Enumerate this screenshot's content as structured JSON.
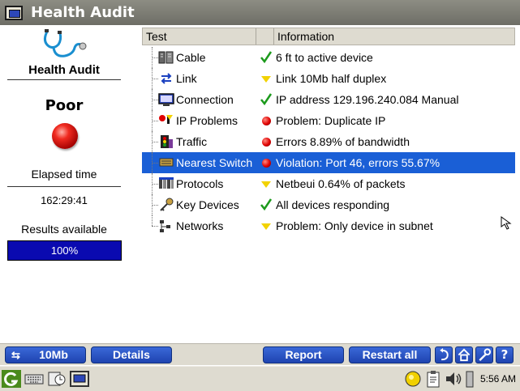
{
  "window": {
    "title": "Health Audit"
  },
  "left_panel": {
    "app_name": "Health Audit",
    "status": "Poor",
    "status_color": "#e00000",
    "elapsed_label": "Elapsed time",
    "elapsed_value": "162:29:41",
    "results_label": "Results available",
    "progress_percent": 100,
    "progress_text": "100%"
  },
  "table": {
    "columns": [
      "Test",
      "",
      "Information"
    ],
    "rows": [
      {
        "name": "Cable",
        "icon": "cable-icon",
        "status": "ok",
        "info": "6 ft to active device",
        "selected": false
      },
      {
        "name": "Link",
        "icon": "link-icon",
        "status": "warning",
        "info": "Link 10Mb half duplex",
        "selected": false
      },
      {
        "name": "Connection",
        "icon": "connection-icon",
        "status": "ok",
        "info": "IP address 129.196.240.084 Manual",
        "selected": false
      },
      {
        "name": "IP Problems",
        "icon": "ip-problems-icon",
        "status": "error",
        "info": "Problem: Duplicate IP",
        "selected": false
      },
      {
        "name": "Traffic",
        "icon": "traffic-icon",
        "status": "error",
        "info": "Errors 8.89% of bandwidth",
        "selected": false
      },
      {
        "name": "Nearest Switch",
        "icon": "switch-icon",
        "status": "error",
        "info": "Violation: Port 46, errors 55.67%",
        "selected": true
      },
      {
        "name": "Protocols",
        "icon": "protocols-icon",
        "status": "warning",
        "info": "Netbeui 0.64% of packets",
        "selected": false
      },
      {
        "name": "Key Devices",
        "icon": "key-devices-icon",
        "status": "ok",
        "info": "All devices responding",
        "selected": false
      },
      {
        "name": "Networks",
        "icon": "networks-icon",
        "status": "warning",
        "info": "Problem: Only device in subnet",
        "selected": false
      }
    ]
  },
  "buttons": {
    "link_speed": "10Mb",
    "details": "Details",
    "report": "Report",
    "restart_all": "Restart all"
  },
  "taskbar": {
    "clock": "5:56 AM"
  },
  "colors": {
    "selection": "#1a5fd6",
    "button": "#2a52c2",
    "progress": "#0a0ab0",
    "ok": "#1c9a1c",
    "warning": "#f2d200",
    "error": "#e00000"
  }
}
